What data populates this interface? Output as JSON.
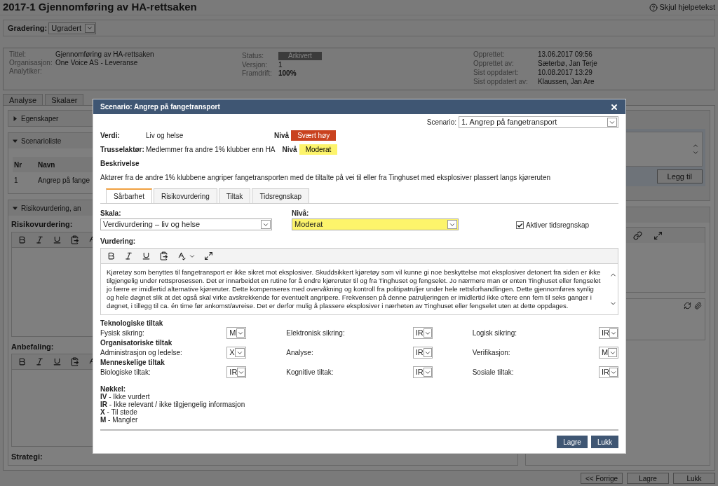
{
  "page": {
    "title": "2017-1 Gjennomføring av HA-rettsaken",
    "help_link": "Skjul hjelpetekst"
  },
  "classification": {
    "label": "Gradering:",
    "value": "Ugradert"
  },
  "info": {
    "col1": [
      {
        "label": "Tittel:",
        "value": "Gjennomføring av HA-rettsaken"
      },
      {
        "label": "Organisasjon:",
        "value": "One Voice AS - Leveranse"
      },
      {
        "label": "Analytiker:"
      }
    ],
    "status": {
      "label": "Status:",
      "value": "Arkivert"
    },
    "col2": [
      {
        "label": "Versjon:",
        "value": "1"
      },
      {
        "label": "Framdrift:",
        "value": "100%"
      }
    ],
    "col3": [
      {
        "label": "Opprettet:",
        "value": "13.06.2017 09:56"
      },
      {
        "label": "Opprettet av:",
        "value": "Sæterbø, Jan Terje"
      },
      {
        "label": "Sist oppdatert:",
        "value": "10.08.2017 13:29"
      },
      {
        "label": "Sist oppdatert av:",
        "value": "Klaussen, Jan Are"
      }
    ]
  },
  "tabs": [
    {
      "label": "Analyse",
      "selected": false
    },
    {
      "label": "Skalaer",
      "selected": false
    }
  ],
  "left_panel": {
    "sections": [
      {
        "title": "Egenskaper",
        "expanded": false
      },
      {
        "title": "Scenarioliste",
        "expanded": true
      },
      {
        "title": "Risikovurdering, an",
        "expanded": true
      }
    ],
    "table": {
      "columns": [
        "Nr",
        "Navn"
      ],
      "rows": [
        [
          "1",
          "Angrep på fange"
        ]
      ]
    },
    "fields": [
      "Risikovurdering:",
      "Anbefaling:",
      "Strategi:"
    ]
  },
  "right_panel": {
    "add_button": "Legg til"
  },
  "footer_buttons": [
    "<< Forrige",
    "Lagre",
    "Lukk"
  ],
  "modal": {
    "title": "Scenario: Angrep på fangetransport",
    "scenario": {
      "label": "Scenario:",
      "value": "1. Angrep på fangetransport"
    },
    "facts": [
      {
        "label": "Verdi:",
        "value": "Liv og helse",
        "level_label": "Nivå",
        "level": "Svært høy",
        "color": "#c9421f"
      },
      {
        "label": "Trusselaktør:",
        "value": "Medlemmer fra andre 1% klubber enn HA",
        "level_label": "Nivå",
        "level": "Moderat",
        "color": "#fdf46b"
      }
    ],
    "description_title": "Beskrivelse",
    "description": "Aktører fra de andre 1% klubbene angriper fangetransporten med de tiltalte på vei til eller fra Tinghuset med eksplosiver plassert langs kjøreruten",
    "tabs": [
      {
        "label": "Sårbarhet",
        "selected": true
      },
      {
        "label": "Risikovurdering",
        "selected": false
      },
      {
        "label": "Tiltak",
        "selected": false
      },
      {
        "label": "Tidsregnskap",
        "selected": false
      }
    ],
    "scale": {
      "label": "Skala:",
      "value": "Verdivurdering – liv og helse"
    },
    "level": {
      "label": "Nivå:",
      "value": "Moderat",
      "color": "#fdf46b"
    },
    "time_tracking": {
      "label": "Aktiver tidsregnskap",
      "checked": true
    },
    "assessment": {
      "label": "Vurdering:",
      "paragraphs": [
        "Kjøretøy som benyttes til fangetransport er ikke sikret mot eksplosiver. Skuddsikkert kjøretøy som vil kunne gi noe beskyttelse mot eksplosiver detonert fra siden er ikke tilgjengelig under rettsprosessen. Det er innarbeidet en rutine for å endre kjøreruter til og fra Tinghuset og fengselet. Jo nærmere man er enten Tinghuset eller fengselet jo færre er imidlertid alternative kjøreruter. Dette kompenseres med overvåkning og kontroll fra politipatruljer under hele rettsforhandlingen. Dette gjennomføres synlig og hele døgnet slik at det også skal virke avskrekkende for eventuelt angripere. Frekvensen på denne patruljeringen er imidlertid ikke oftere enn fem til seks ganger i døgnet, i tillegg til ca. én time før ankomst/avreise. Det er derfor mulig å plassere eksplosiver i nærheten av Tinghuset eller fengselet uten at dette oppdages."
      ]
    },
    "measure_groups": [
      {
        "title": "Teknologiske tiltak",
        "items": [
          {
            "label": "Fysisk sikring:",
            "value": "M"
          },
          {
            "label": "Elektronisk sikring:",
            "value": "IR"
          },
          {
            "label": "Logisk sikring:",
            "value": "IR"
          }
        ]
      },
      {
        "title": "Organisatoriske tiltak",
        "items": [
          {
            "label": "Administrasjon og ledelse:",
            "value": "X"
          },
          {
            "label": "Analyse:",
            "value": "IR"
          },
          {
            "label": "Verifikasjon:",
            "value": "M"
          }
        ]
      },
      {
        "title": "Menneskelige tiltak",
        "items": [
          {
            "label": "Biologiske tiltak:",
            "value": "IR"
          },
          {
            "label": "Kognitive tiltak:",
            "value": "IR"
          },
          {
            "label": "Sosiale tiltak:",
            "value": "IR"
          }
        ]
      }
    ],
    "key": {
      "title": "Nøkkel:",
      "items": [
        {
          "code": "IV",
          "text": " - Ikke vurdert"
        },
        {
          "code": "IR",
          "text": " - Ikke relevant / ikke tilgjengelig informasjon"
        },
        {
          "code": "X",
          "text": " - Til stede"
        },
        {
          "code": "M",
          "text": " - Mangler"
        }
      ]
    },
    "buttons": [
      "Lagre",
      "Lukk"
    ]
  }
}
